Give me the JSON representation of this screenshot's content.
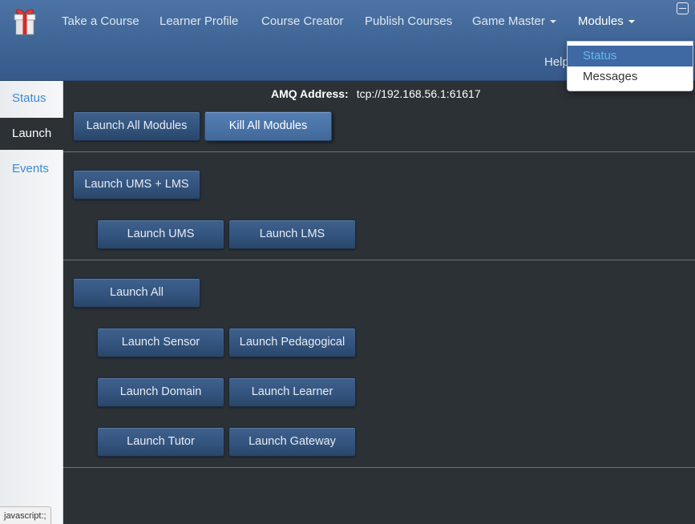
{
  "navbar": {
    "logo_icon": "gift-box-icon",
    "items": [
      {
        "label": "Take a Course"
      },
      {
        "label": "Learner Profile"
      },
      {
        "label": "Course Creator"
      },
      {
        "label": "Publish Courses"
      },
      {
        "label": "Game Master"
      },
      {
        "label": "Modules"
      }
    ],
    "help_label": "Help",
    "accent_color": "#4a73a8"
  },
  "modules_dropdown": {
    "items": [
      {
        "label": "Status",
        "selected": true
      },
      {
        "label": "Messages",
        "selected": false
      }
    ]
  },
  "sidebar": {
    "items": [
      {
        "label": "Status"
      },
      {
        "label": "Launch"
      },
      {
        "label": "Events"
      }
    ],
    "active": "Launch"
  },
  "main": {
    "amq_label": "AMQ Address:",
    "amq_value": "tcp://192.168.56.1:61617",
    "buttons": {
      "launch_all_modules": "Launch All Modules",
      "kill_all_modules": "Kill All Modules",
      "launch_ums_lms": "Launch UMS + LMS",
      "launch_ums": "Launch UMS",
      "launch_lms": "Launch LMS",
      "launch_all": "Launch All",
      "launch_sensor": "Launch Sensor",
      "launch_pedagogical": "Launch Pedagogical",
      "launch_domain": "Launch Domain",
      "launch_learner": "Launch Learner",
      "launch_tutor": "Launch Tutor",
      "launch_gateway": "Launch Gateway"
    }
  },
  "status_bar": {
    "text": "javascript:;"
  }
}
